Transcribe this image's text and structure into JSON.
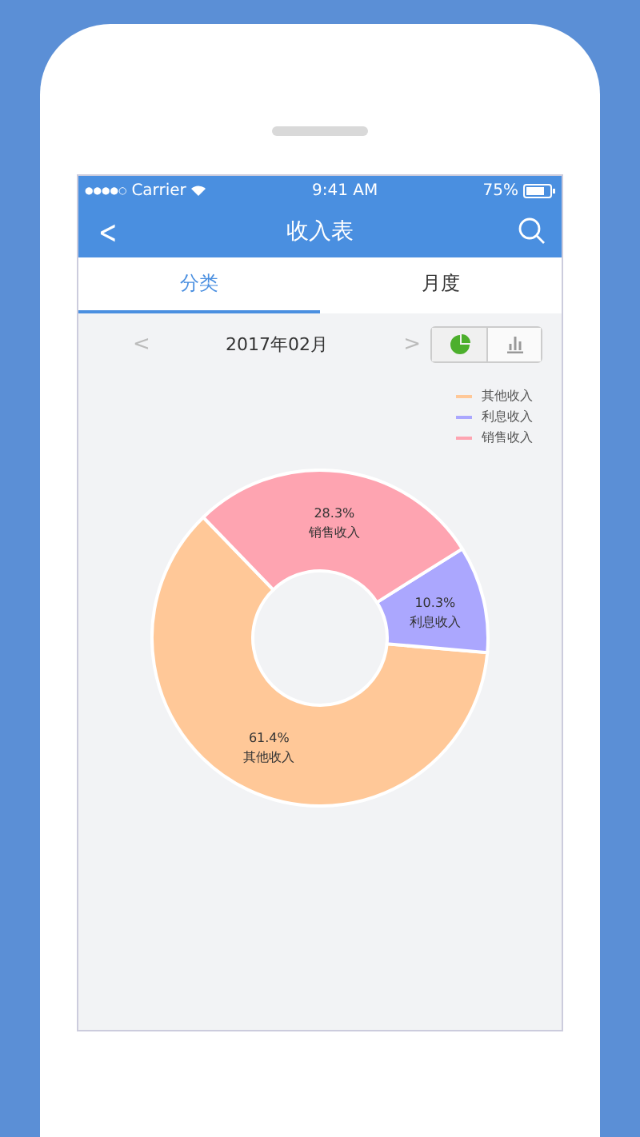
{
  "status_bar": {
    "signal": "●●●●○",
    "carrier": "Carrier",
    "time": "9:41 AM",
    "battery": "75%"
  },
  "nav_bar": {
    "back": "<",
    "title": "收入表"
  },
  "tabs": [
    {
      "label": "分类",
      "selected": true
    },
    {
      "label": "月度",
      "selected": false
    }
  ],
  "period": {
    "prev": "<",
    "label": "2017年02月",
    "next": ">"
  },
  "view_toggle": [
    {
      "kind": "pie",
      "selected": true
    },
    {
      "kind": "bar",
      "selected": false
    }
  ],
  "chart": {
    "chart_data": {
      "type": "donut",
      "categories": [
        "其他收入",
        "利息收入",
        "销售收入"
      ],
      "value_labels": [
        "61.4%",
        "10.3%",
        "28.3%"
      ],
      "legend": true,
      "series": [
        {
          "values": [
            61.4,
            10.3,
            28.3
          ],
          "colors": [
            "#ffc898",
            "#aba7fe",
            "#fea4b1"
          ]
        }
      ]
    }
  }
}
